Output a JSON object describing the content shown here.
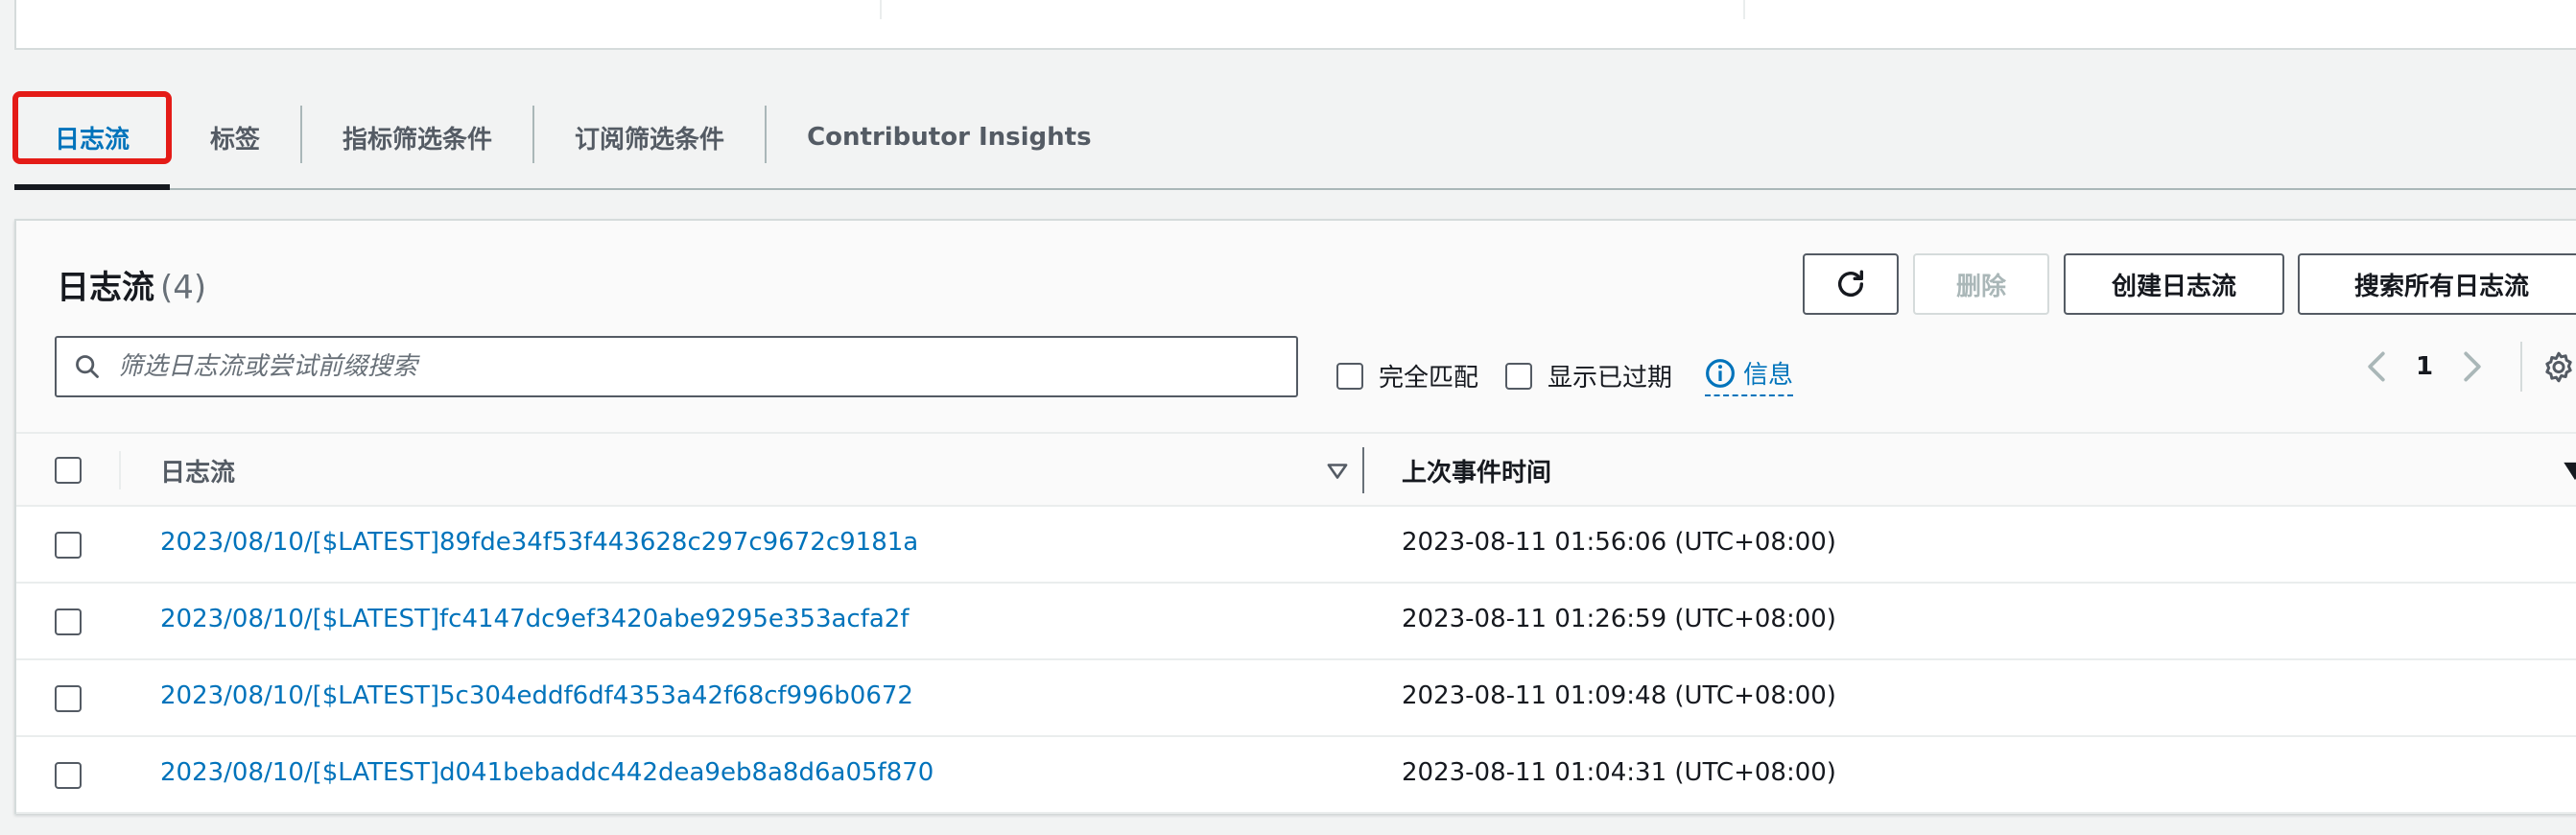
{
  "tabs": [
    {
      "label": "日志流",
      "active": true
    },
    {
      "label": "标签",
      "active": false
    },
    {
      "label": "指标筛选条件",
      "active": false
    },
    {
      "label": "订阅筛选条件",
      "active": false
    },
    {
      "label": "Contributor Insights",
      "active": false
    }
  ],
  "panel": {
    "title": "日志流",
    "count": "(4)",
    "buttons": {
      "refresh_icon": "refresh-icon",
      "delete": "删除",
      "create": "创建日志流",
      "search_all": "搜索所有日志流"
    },
    "search": {
      "placeholder": "筛选日志流或尝试前缀搜索",
      "value": ""
    },
    "options": {
      "exact_match": "完全匹配",
      "show_expired": "显示已过期",
      "info": "信息"
    },
    "pagination": {
      "current_page": "1"
    }
  },
  "table": {
    "columns": {
      "name": "日志流",
      "last_event": "上次事件时间"
    },
    "rows": [
      {
        "name": "2023/08/10/[$LATEST]89fde34f53f443628c297c9672c9181a",
        "time": "2023-08-11 01:56:06 (UTC+08:00)"
      },
      {
        "name": "2023/08/10/[$LATEST]fc4147dc9ef3420abe9295e353acfa2f",
        "time": "2023-08-11 01:26:59 (UTC+08:00)"
      },
      {
        "name": "2023/08/10/[$LATEST]5c304eddf6df4353a42f68cf996b0672",
        "time": "2023-08-11 01:09:48 (UTC+08:00)"
      },
      {
        "name": "2023/08/10/[$LATEST]d041bebaddc442dea9eb8a8d6a05f870",
        "time": "2023-08-11 01:04:31 (UTC+08:00)"
      }
    ]
  },
  "colors": {
    "link": "#0073bb",
    "highlight": "#e41b17",
    "text": "#16191f",
    "muted": "#545b64"
  }
}
